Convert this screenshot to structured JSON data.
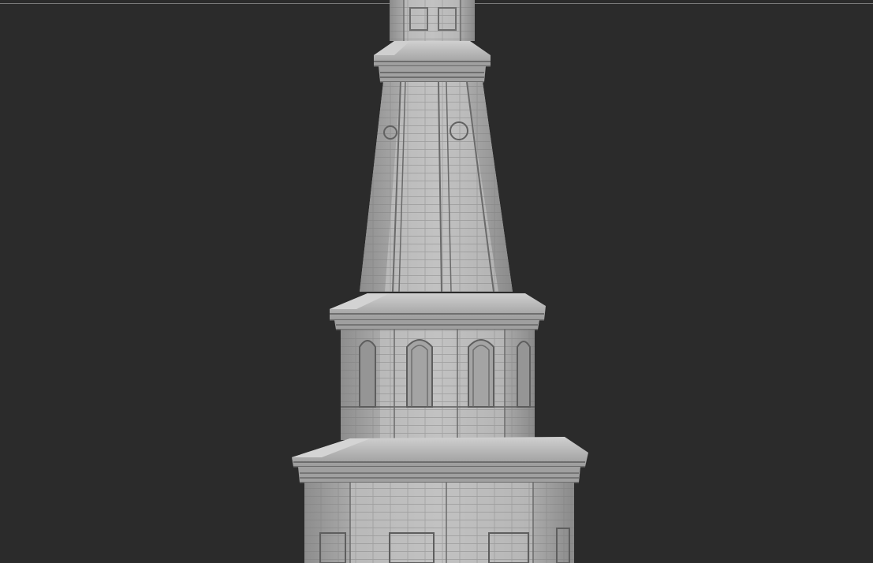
{
  "viewport": {
    "background": "#2b2b2b"
  },
  "model": {
    "subject": "sculpted-tower-spire",
    "material_color": "#a7a7a7"
  }
}
